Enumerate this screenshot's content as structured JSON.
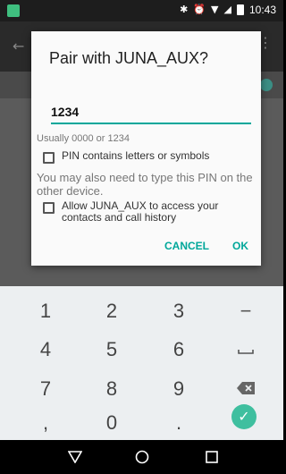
{
  "status_bar": {
    "time": "10:43",
    "icons": [
      "bluetooth-icon",
      "alarm-icon",
      "wifi-icon",
      "signal-icon",
      "battery-icon"
    ]
  },
  "dialog": {
    "title": "Pair with JUNA_AUX?",
    "pin_value": "1234",
    "hint": "Usually 0000 or 1234",
    "checkbox_pin_letters": "PIN contains letters or symbols",
    "also_text": "You may also need to type this PIN on the other device.",
    "checkbox_access": "Allow JUNA_AUX to access your contacts and call history",
    "cancel_label": "CANCEL",
    "ok_label": "OK",
    "accent_color": "#00a79a"
  },
  "keyboard": {
    "row1": [
      "1",
      "2",
      "3",
      "−"
    ],
    "row2": [
      "4",
      "5",
      "6"
    ],
    "row3": [
      "7",
      "8",
      "9"
    ],
    "row4_left": ",",
    "row4_mid": "0",
    "row4_right": "."
  },
  "nav_bar": {
    "buttons": [
      "back-icon",
      "home-icon",
      "recents-icon"
    ]
  }
}
